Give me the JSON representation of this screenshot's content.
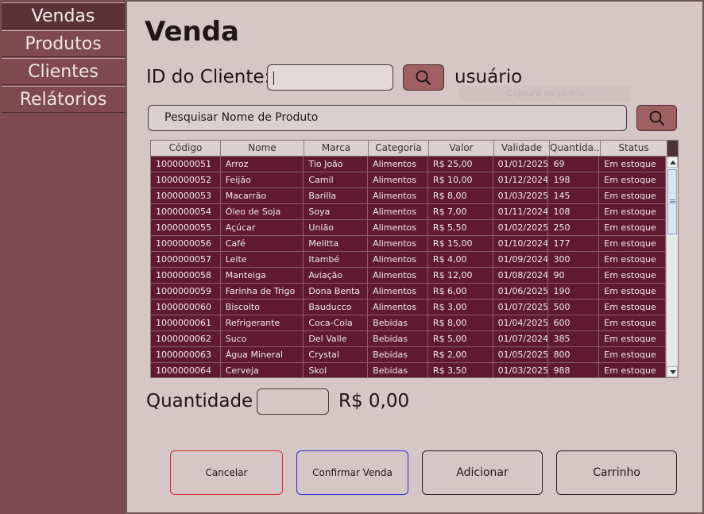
{
  "sidebar": {
    "items": [
      {
        "label": "Vendas"
      },
      {
        "label": "Produtos"
      },
      {
        "label": "Clientes"
      },
      {
        "label": "Relátorios"
      }
    ]
  },
  "page": {
    "title": "Venda",
    "client_id_label": "ID do Cliente:",
    "client_id_value": "",
    "user_label": "usuário",
    "tooltip_ghost": "Captura de Janela",
    "product_search_placeholder": "Pesquisar Nome de Produto"
  },
  "table": {
    "headers": [
      "Código",
      "Nome",
      "Marca",
      "Categoria",
      "Valor",
      "Validade",
      "Quantida...",
      "Status"
    ],
    "rows": [
      [
        "1000000051",
        "Arroz",
        "Tio João",
        "Alimentos",
        "R$ 25,00",
        "01/01/2025",
        "69",
        "Em estoque"
      ],
      [
        "1000000052",
        "Feijão",
        "Camil",
        "Alimentos",
        "R$ 10,00",
        "01/12/2024",
        "198",
        "Em estoque"
      ],
      [
        "1000000053",
        "Macarrão",
        "Barilla",
        "Alimentos",
        "R$ 8,00",
        "01/03/2025",
        "145",
        "Em estoque"
      ],
      [
        "1000000054",
        "Óleo de Soja",
        "Soya",
        "Alimentos",
        "R$ 7,00",
        "01/11/2024",
        "108",
        "Em estoque"
      ],
      [
        "1000000055",
        "Açúcar",
        "União",
        "Alimentos",
        "R$ 5,50",
        "01/02/2025",
        "250",
        "Em estoque"
      ],
      [
        "1000000056",
        "Café",
        "Melitta",
        "Alimentos",
        "R$ 15,00",
        "01/10/2024",
        "177",
        "Em estoque"
      ],
      [
        "1000000057",
        "Leite",
        "Itambé",
        "Alimentos",
        "R$ 4,00",
        "01/09/2024",
        "300",
        "Em estoque"
      ],
      [
        "1000000058",
        "Manteiga",
        "Aviação",
        "Alimentos",
        "R$ 12,00",
        "01/08/2024",
        "90",
        "Em estoque"
      ],
      [
        "1000000059",
        "Farinha de Trigo",
        "Dona Benta",
        "Alimentos",
        "R$ 6,00",
        "01/06/2025",
        "190",
        "Em estoque"
      ],
      [
        "1000000060",
        "Biscoito",
        "Bauducco",
        "Alimentos",
        "R$ 3,00",
        "01/07/2025",
        "500",
        "Em estoque"
      ],
      [
        "1000000061",
        "Refrigerante",
        "Coca-Cola",
        "Bebidas",
        "R$ 8,00",
        "01/04/2025",
        "600",
        "Em estoque"
      ],
      [
        "1000000062",
        "Suco",
        "Del Valle",
        "Bebidas",
        "R$ 5,00",
        "01/07/2024",
        "385",
        "Em estoque"
      ],
      [
        "1000000063",
        "Água Mineral",
        "Crystal",
        "Bebidas",
        "R$ 2,00",
        "01/05/2025",
        "800",
        "Em estoque"
      ],
      [
        "1000000064",
        "Cerveja",
        "Skol",
        "Bebidas",
        "R$ 3,50",
        "01/03/2025",
        "988",
        "Em estoque"
      ]
    ]
  },
  "quantity": {
    "label": "Quantidade",
    "value": "",
    "total": "R$ 0,00"
  },
  "buttons": {
    "cancel": "Cancelar",
    "confirm": "Confirmar Venda",
    "add": "Adicionar",
    "cart": "Carrinho"
  },
  "icons": {
    "search": "search-icon"
  },
  "colors": {
    "sidebar_bg": "#7b4b4f",
    "active_nav": "#5b3337",
    "main_bg": "#d6c6c6",
    "table_row_bg": "#5f1a31",
    "search_button": "#a05f60",
    "cancel_border": "#d42b2b",
    "confirm_border": "#2b2bd4"
  }
}
